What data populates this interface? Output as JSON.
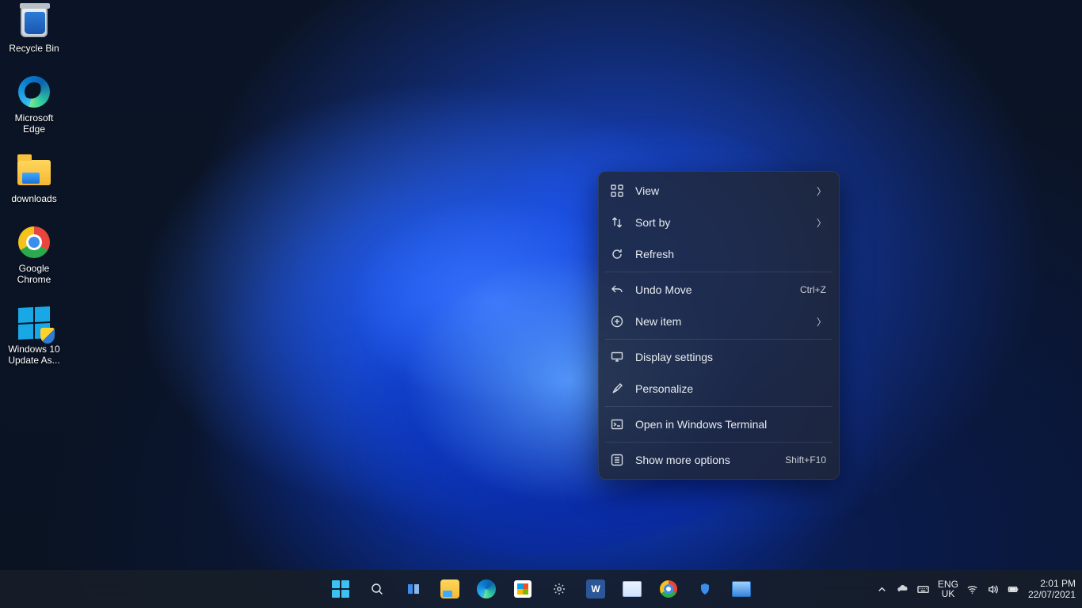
{
  "desktop_icons": [
    {
      "id": "recycle-bin",
      "label": "Recycle Bin"
    },
    {
      "id": "edge",
      "label": "Microsoft Edge"
    },
    {
      "id": "downloads",
      "label": "downloads"
    },
    {
      "id": "chrome",
      "label": "Google Chrome"
    },
    {
      "id": "win10-update",
      "label": "Windows 10 Update As..."
    }
  ],
  "context_menu": {
    "view": {
      "label": "View"
    },
    "sortby": {
      "label": "Sort by"
    },
    "refresh": {
      "label": "Refresh"
    },
    "undo": {
      "label": "Undo Move",
      "accel": "Ctrl+Z"
    },
    "newitem": {
      "label": "New item"
    },
    "display": {
      "label": "Display settings"
    },
    "personalize": {
      "label": "Personalize"
    },
    "terminal": {
      "label": "Open in Windows Terminal"
    },
    "more": {
      "label": "Show more options",
      "accel": "Shift+F10"
    }
  },
  "taskbar": {
    "tray": {
      "lang_top": "ENG",
      "lang_bottom": "UK",
      "time": "2:01 PM",
      "date": "22/07/2021"
    },
    "word_glyph": "W"
  }
}
